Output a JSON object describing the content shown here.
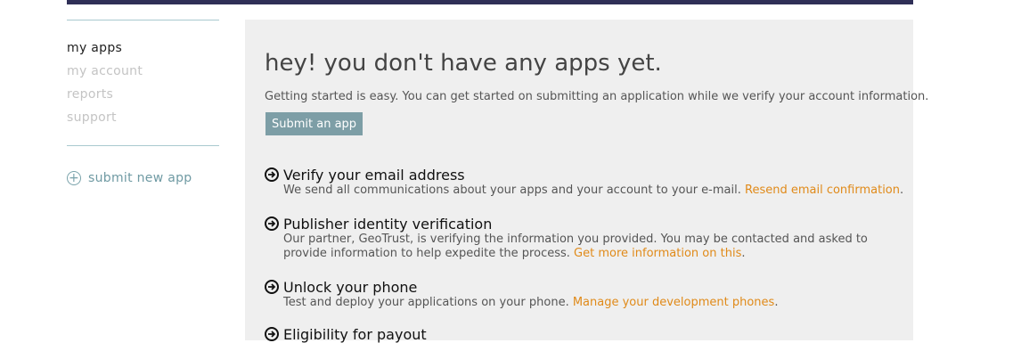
{
  "sidebar": {
    "nav": [
      {
        "label": "my apps",
        "active": true
      },
      {
        "label": "my account",
        "active": false
      },
      {
        "label": "reports",
        "active": false
      },
      {
        "label": "support",
        "active": false
      }
    ],
    "submit_new_app": "submit new app",
    "submit_icon": "plus-circle-icon"
  },
  "main": {
    "headline": "hey! you don't have any apps yet.",
    "intro": "Getting started is easy. You can get started on submitting an application while we verify your account information.",
    "submit_button": "Submit an app",
    "steps": [
      {
        "title": "Verify your email address",
        "text": "We send all communications about your apps and your account to your e-mail.",
        "link": "Resend email confirmation",
        "suffix": "."
      },
      {
        "title": "Publisher identity verification",
        "text": "Our partner, GeoTrust, is verifying the information you provided. You may be contacted and asked to provide information to help expedite the process.",
        "link": "Get more information on this",
        "suffix": "."
      },
      {
        "title": "Unlock your phone",
        "text": "Test and deploy your applications on your phone.",
        "link": "Manage your development phones",
        "suffix": "."
      },
      {
        "title": "Eligibility for payout",
        "text": "",
        "link": "",
        "suffix": ""
      }
    ]
  },
  "colors": {
    "top_bar": "#2f2f57",
    "panel_bg": "#efefef",
    "link": "#e08a19",
    "button_bg": "#7d9ea6",
    "sidebar_rule": "#a9c9cf"
  }
}
